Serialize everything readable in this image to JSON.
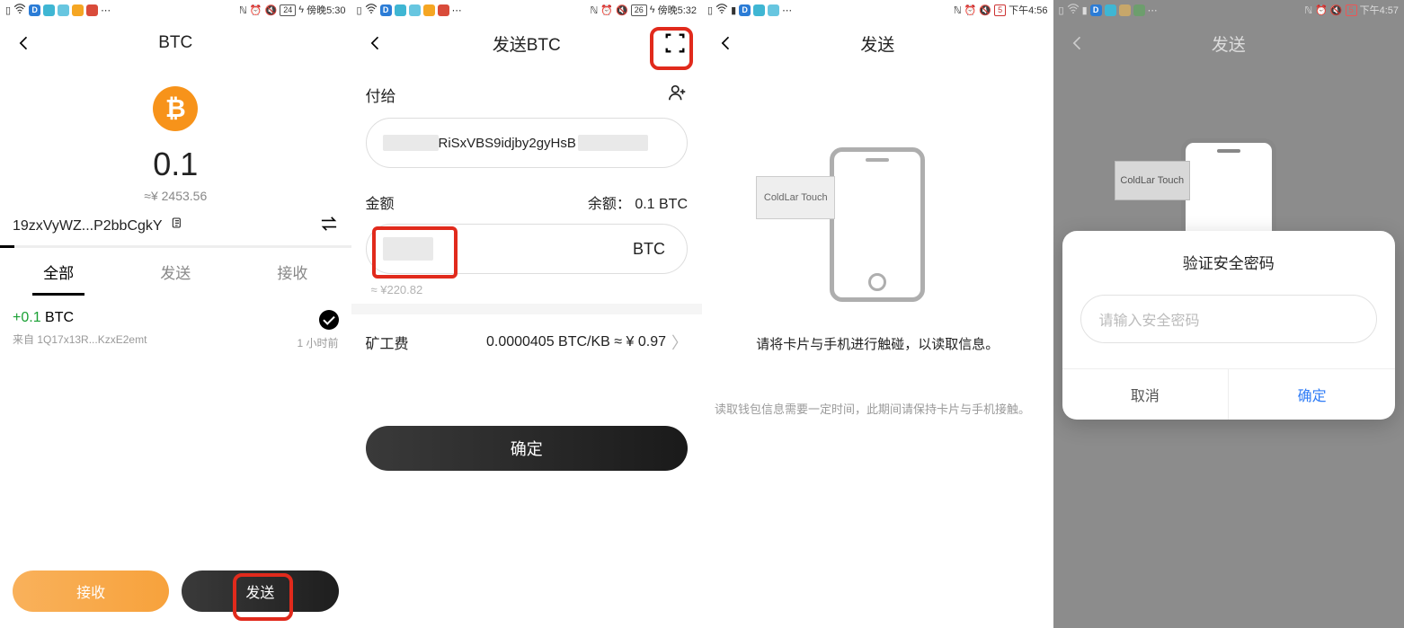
{
  "screen1": {
    "status": {
      "battery": "24",
      "time": "傍晚5:30"
    },
    "title": "BTC",
    "coin_glyph": "₿",
    "amount": "0.1",
    "fiat_prefix": "≈¥  ",
    "fiat_value": "2453.56",
    "address_short": "19zxVyWZ...P2bbCgkY",
    "tabs": {
      "all": "全部",
      "send": "发送",
      "recv": "接收"
    },
    "tx": {
      "amount_sign": "+0.1",
      "amount_unit": " BTC",
      "from_label": "来自 ",
      "from_addr": "1Q17x13R...KzxE2emt",
      "time_ago": "1 小时前"
    },
    "actions": {
      "receive": "接收",
      "send": "发送"
    }
  },
  "screen2": {
    "status": {
      "battery": "26",
      "time": "傍晚5:32"
    },
    "title": "发送BTC",
    "pay_to_label": "付给",
    "recipient_visible": "RiSxVBS9idjby2gyHsB",
    "amount_label": "金额",
    "balance_label": "余额：",
    "balance_value": "0.1 BTC",
    "amount_unit": "BTC",
    "estimate_fiat": "≈ ¥220.82",
    "fee_label": "矿工费",
    "fee_value": "0.0000405 BTC/KB ≈ ¥ 0.97",
    "confirm": "确定"
  },
  "screen3": {
    "status": {
      "battery": "5",
      "time": "下午4:56"
    },
    "title": "发送",
    "card_text": "ColdLar Touch",
    "pair_msg": "请将卡片与手机进行触碰，以读取信息。",
    "note": "读取钱包信息需要一定时间，此期间请保持卡片与手机接触。"
  },
  "screen4": {
    "status": {
      "battery": "5",
      "time": "下午4:57"
    },
    "title": "发送",
    "card_text": "ColdLar Touch",
    "dialog": {
      "title": "验证安全密码",
      "placeholder": "请输入安全密码",
      "cancel": "取消",
      "ok": "确定"
    }
  }
}
